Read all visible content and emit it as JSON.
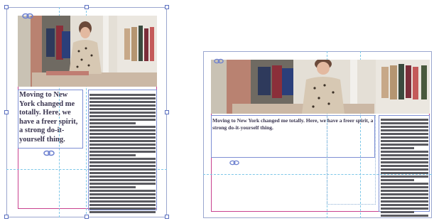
{
  "left_layout": {
    "story_text": "Moving to New York changed me totally. Here, we have a freer spirit, a strong do-it-yourself thing.",
    "placeholder_line_count": 34
  },
  "right_layout": {
    "story_text": "Moving to New York changed me totally. Here, we have a freer spirit, a strong do-it-yourself thing.",
    "placeholder_line_count": 28
  },
  "colors": {
    "guide_blue": "#7cc7e8",
    "margin_magenta": "#c9418f",
    "frame_blue": "#7e8fd4"
  },
  "icons": [
    "link-chain-icon",
    "selection-handle-icon"
  ]
}
